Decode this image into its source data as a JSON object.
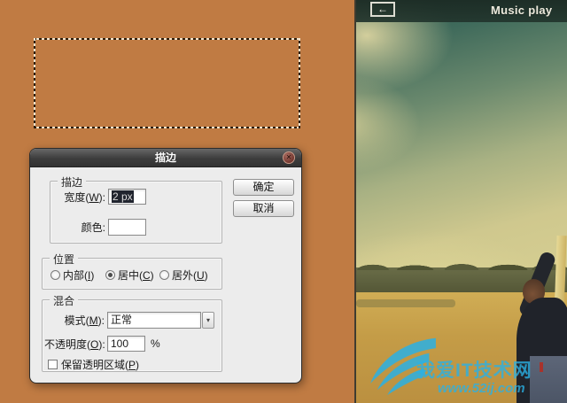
{
  "colors": {
    "canvas_bg": "#c07b43",
    "header_teal": "#22352d",
    "watermark_cyan": "#2bb1e4"
  },
  "dialog": {
    "title": "描边",
    "close_glyph": "✕",
    "buttons": {
      "ok": "确定",
      "cancel": "取消"
    },
    "stroke_group": {
      "legend": "描边",
      "width_label": {
        "pre": "宽度(",
        "key": "W",
        "post": "):"
      },
      "width_value": "2 px",
      "color_label": "颜色:"
    },
    "position_group": {
      "legend": "位置",
      "selected_index": 1,
      "options": [
        {
          "pre": "内部(",
          "key": "I",
          "post": ")"
        },
        {
          "pre": "居中(",
          "key": "C",
          "post": ")"
        },
        {
          "pre": "居外(",
          "key": "U",
          "post": ")"
        }
      ]
    },
    "blend_group": {
      "legend": "混合",
      "mode_label": {
        "pre": "模式(",
        "key": "M",
        "post": "):"
      },
      "mode_value": "正常",
      "dropdown_glyph": "▾",
      "opacity_label": {
        "pre": "不透明度(",
        "key": "O",
        "post": "):"
      },
      "opacity_value": "100",
      "opacity_unit": "%",
      "preserve_label": {
        "pre": "保留透明区域(",
        "key": "P",
        "post": ")"
      },
      "preserve_checked": false
    }
  },
  "preview": {
    "back_glyph": "←",
    "header_title": "Music play",
    "watermark": {
      "line1": "我爱IT技术网",
      "line2": "www.52ij.com"
    }
  }
}
